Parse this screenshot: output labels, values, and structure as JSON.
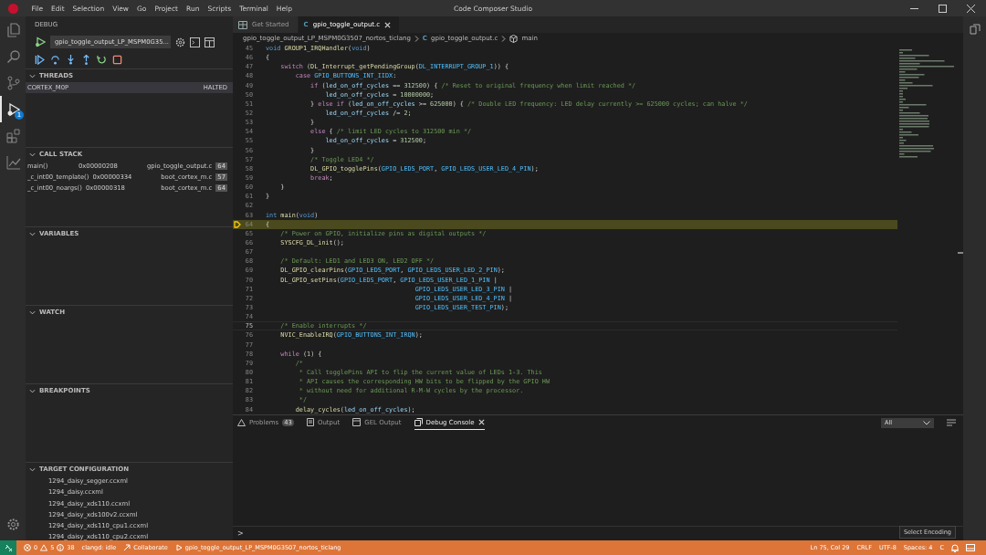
{
  "window": {
    "title": "Code Composer Studio"
  },
  "menu": [
    "File",
    "Edit",
    "Selection",
    "View",
    "Go",
    "Project",
    "Run",
    "Scripts",
    "Terminal",
    "Help"
  ],
  "activity_bar": [
    {
      "kind": "files",
      "selected": false
    },
    {
      "kind": "search",
      "selected": false
    },
    {
      "kind": "source-control",
      "selected": false
    },
    {
      "kind": "debug",
      "selected": true,
      "badge": "1"
    },
    {
      "kind": "extensions",
      "selected": false
    },
    {
      "kind": "chart",
      "selected": false
    }
  ],
  "sidebar": {
    "title": "DEBUG",
    "launch_config": "gpio_toggle_output_LP_MSPM0G35...",
    "sections": [
      {
        "kind": "threads",
        "title": "THREADS",
        "expanded": true,
        "rows": [
          {
            "name": "CORTEX_M0P",
            "state": "HALTED",
            "selected": true
          }
        ]
      },
      {
        "kind": "callstack",
        "title": "CALL STACK",
        "expanded": true,
        "frames": [
          {
            "name": "main()",
            "address": "0x00000208",
            "file": "gpio_toggle_output.c",
            "line": "64"
          },
          {
            "name": "_c_int00_template()",
            "address": "0x00000334",
            "file": "boot_cortex_m.c",
            "line": "57"
          },
          {
            "name": "_c_int00_noargs()",
            "address": "0x00000318",
            "file": "boot_cortex_m.c",
            "line": "64"
          }
        ]
      },
      {
        "kind": "empty",
        "title": "VARIABLES",
        "expanded": true
      },
      {
        "kind": "empty",
        "title": "WATCH",
        "expanded": true
      },
      {
        "kind": "empty",
        "title": "BREAKPOINTS",
        "expanded": true
      },
      {
        "kind": "files",
        "title": "TARGET CONFIGURATION",
        "expanded": true,
        "items": [
          "1294_daisy_segger.ccxml",
          "1294_daisy.ccxml",
          "1294_daisy_xds110.ccxml",
          "1294_daisy_xds100v2.ccxml",
          "1294_daisy_xds110_cpu1.ccxml",
          "1294_daisy_xds110_cpu2.ccxml"
        ]
      }
    ]
  },
  "editor": {
    "tabs": [
      {
        "label": "Get Started",
        "kind": "welcome",
        "selected": false
      },
      {
        "label": "gpio_toggle_output.c",
        "kind": "c",
        "icon": "C",
        "selected": true
      }
    ],
    "breadcrumb": [
      {
        "label": "gpio_toggle_output_LP_MSPM0G3507_nortos_ticlang",
        "kind": "folder"
      },
      {
        "label": "gpio_toggle_output.c",
        "kind": "file",
        "icon": "C"
      },
      {
        "label": "main",
        "kind": "symbol"
      }
    ],
    "lines": [
      {
        "n": "45",
        "tokens": [
          {
            "kind": "ty",
            "text": "void"
          },
          {
            "kind": "fn",
            "text": " GROUP1_IRQHandler"
          },
          {
            "kind": "p",
            "text": "("
          },
          {
            "kind": "ty",
            "text": "void"
          },
          {
            "kind": "p",
            "text": ")"
          }
        ]
      },
      {
        "n": "46",
        "tokens": [
          {
            "kind": "p",
            "text": "{"
          }
        ]
      },
      {
        "n": "47",
        "tokens": [
          {
            "kind": "kw",
            "text": "    switch"
          },
          {
            "kind": "p",
            "text": " ("
          },
          {
            "kind": "fn",
            "text": "DL_Interrupt_getPendingGroup"
          },
          {
            "kind": "p",
            "text": "("
          },
          {
            "kind": "mac",
            "text": "DL_INTERRUPT_GROUP_1"
          },
          {
            "kind": "p",
            "text": ")) {"
          }
        ]
      },
      {
        "n": "48",
        "tokens": [
          {
            "kind": "kw",
            "text": "        case"
          },
          {
            "kind": "mac",
            "text": " GPIO_BUTTONS_INT_IIDX"
          },
          {
            "kind": "p",
            "text": ":"
          }
        ]
      },
      {
        "n": "49",
        "tokens": [
          {
            "kind": "kw",
            "text": "            if"
          },
          {
            "kind": "p",
            "text": " ("
          },
          {
            "kind": "var",
            "text": "led_on_off_cycles"
          },
          {
            "kind": "p",
            "text": " == "
          },
          {
            "kind": "num",
            "text": "312500"
          },
          {
            "kind": "p",
            "text": ") { "
          },
          {
            "kind": "cm",
            "text": "/* Reset to original frequency when limit reached */"
          }
        ]
      },
      {
        "n": "50",
        "tokens": [
          {
            "kind": "var",
            "text": "                led_on_off_cycles"
          },
          {
            "kind": "p",
            "text": " = "
          },
          {
            "kind": "num",
            "text": "10000000"
          },
          {
            "kind": "p",
            "text": ";"
          }
        ]
      },
      {
        "n": "51",
        "tokens": [
          {
            "kind": "p",
            "text": "            } "
          },
          {
            "kind": "kw",
            "text": "else if"
          },
          {
            "kind": "p",
            "text": " ("
          },
          {
            "kind": "var",
            "text": "led_on_off_cycles"
          },
          {
            "kind": "p",
            "text": " >= "
          },
          {
            "kind": "num",
            "text": "625000"
          },
          {
            "kind": "p",
            "text": ") { "
          },
          {
            "kind": "cm",
            "text": "/* Double LED frequency: LED delay currently >= 625000 cycles; can halve */"
          }
        ]
      },
      {
        "n": "52",
        "tokens": [
          {
            "kind": "var",
            "text": "                led_on_off_cycles"
          },
          {
            "kind": "p",
            "text": " /= "
          },
          {
            "kind": "num",
            "text": "2"
          },
          {
            "kind": "p",
            "text": ";"
          }
        ]
      },
      {
        "n": "53",
        "tokens": [
          {
            "kind": "p",
            "text": "            }"
          }
        ]
      },
      {
        "n": "54",
        "tokens": [
          {
            "kind": "kw",
            "text": "            else"
          },
          {
            "kind": "p",
            "text": " { "
          },
          {
            "kind": "cm",
            "text": "/* limit LED cycles to 312500 min */"
          }
        ]
      },
      {
        "n": "55",
        "tokens": [
          {
            "kind": "var",
            "text": "                led_on_off_cycles"
          },
          {
            "kind": "p",
            "text": " = "
          },
          {
            "kind": "num",
            "text": "312500"
          },
          {
            "kind": "p",
            "text": ";"
          }
        ]
      },
      {
        "n": "56",
        "tokens": [
          {
            "kind": "p",
            "text": "            }"
          }
        ]
      },
      {
        "n": "57",
        "tokens": [
          {
            "kind": "cm",
            "text": "            /* Toggle LED4 */"
          }
        ]
      },
      {
        "n": "58",
        "tokens": [
          {
            "kind": "fn",
            "text": "            DL_GPIO_togglePins"
          },
          {
            "kind": "p",
            "text": "("
          },
          {
            "kind": "mac",
            "text": "GPIO_LEDS_PORT"
          },
          {
            "kind": "p",
            "text": ", "
          },
          {
            "kind": "mac",
            "text": "GPIO_LEDS_USER_LED_4_PIN"
          },
          {
            "kind": "p",
            "text": ");"
          }
        ]
      },
      {
        "n": "59",
        "tokens": [
          {
            "kind": "kw",
            "text": "            break"
          },
          {
            "kind": "p",
            "text": ";"
          }
        ]
      },
      {
        "n": "60",
        "tokens": [
          {
            "kind": "p",
            "text": "    }"
          }
        ]
      },
      {
        "n": "61",
        "tokens": [
          {
            "kind": "p",
            "text": "}"
          }
        ]
      },
      {
        "n": "62"
      },
      {
        "n": "63",
        "tokens": [
          {
            "kind": "ty",
            "text": "int"
          },
          {
            "kind": "fn",
            "text": " main"
          },
          {
            "kind": "p",
            "text": "("
          },
          {
            "kind": "ty",
            "text": "void"
          },
          {
            "kind": "p",
            "text": ")"
          }
        ]
      },
      {
        "n": "64",
        "current": true,
        "tokens": [
          {
            "kind": "p",
            "text": "{"
          }
        ]
      },
      {
        "n": "65",
        "tokens": [
          {
            "kind": "cm",
            "text": "    /* Power on GPIO, initialize pins as digital outputs */"
          }
        ]
      },
      {
        "n": "66",
        "tokens": [
          {
            "kind": "fn",
            "text": "    SYSCFG_DL_init"
          },
          {
            "kind": "p",
            "text": "();"
          }
        ]
      },
      {
        "n": "67"
      },
      {
        "n": "68",
        "tokens": [
          {
            "kind": "cm",
            "text": "    /* Default: LED1 and LED3 ON, LED2 OFF */"
          }
        ]
      },
      {
        "n": "69",
        "tokens": [
          {
            "kind": "fn",
            "text": "    DL_GPIO_clearPins"
          },
          {
            "kind": "p",
            "text": "("
          },
          {
            "kind": "mac",
            "text": "GPIO_LEDS_PORT"
          },
          {
            "kind": "p",
            "text": ", "
          },
          {
            "kind": "mac",
            "text": "GPIO_LEDS_USER_LED_2_PIN"
          },
          {
            "kind": "p",
            "text": ");"
          }
        ]
      },
      {
        "n": "70",
        "tokens": [
          {
            "kind": "fn",
            "text": "    DL_GPIO_setPins"
          },
          {
            "kind": "p",
            "text": "("
          },
          {
            "kind": "mac",
            "text": "GPIO_LEDS_PORT"
          },
          {
            "kind": "p",
            "text": ", "
          },
          {
            "kind": "mac",
            "text": "GPIO_LEDS_USER_LED_1_PIN"
          },
          {
            "kind": "p",
            "text": " |"
          }
        ]
      },
      {
        "n": "71",
        "tokens": [
          {
            "kind": "mac",
            "text": "                                        GPIO_LEDS_USER_LED_3_PIN"
          },
          {
            "kind": "p",
            "text": " |"
          }
        ]
      },
      {
        "n": "72",
        "tokens": [
          {
            "kind": "mac",
            "text": "                                        GPIO_LEDS_USER_LED_4_PIN"
          },
          {
            "kind": "p",
            "text": " |"
          }
        ]
      },
      {
        "n": "73",
        "tokens": [
          {
            "kind": "mac",
            "text": "                                        GPIO_LEDS_USER_TEST_PIN"
          },
          {
            "kind": "p",
            "text": ");"
          }
        ]
      },
      {
        "n": "74"
      },
      {
        "n": "75",
        "cursor": true,
        "tokens": [
          {
            "kind": "cm",
            "text": "    /* Enable interrupts */"
          }
        ]
      },
      {
        "n": "76",
        "tokens": [
          {
            "kind": "fn",
            "text": "    NVIC_EnableIRQ"
          },
          {
            "kind": "p",
            "text": "("
          },
          {
            "kind": "mac",
            "text": "GPIO_BUTTONS_INT_IRQN"
          },
          {
            "kind": "p",
            "text": ");"
          }
        ]
      },
      {
        "n": "77"
      },
      {
        "n": "78",
        "tokens": [
          {
            "kind": "kw",
            "text": "    while"
          },
          {
            "kind": "p",
            "text": " ("
          },
          {
            "kind": "num",
            "text": "1"
          },
          {
            "kind": "p",
            "text": ") {"
          }
        ]
      },
      {
        "n": "79",
        "tokens": [
          {
            "kind": "cm",
            "text": "        /*"
          }
        ]
      },
      {
        "n": "80",
        "tokens": [
          {
            "kind": "cm",
            "text": "         * Call togglePins API to flip the current value of LEDs 1-3. This"
          }
        ]
      },
      {
        "n": "81",
        "tokens": [
          {
            "kind": "cm",
            "text": "         * API causes the corresponding HW bits to be flipped by the GPIO HW"
          }
        ]
      },
      {
        "n": "82",
        "tokens": [
          {
            "kind": "cm",
            "text": "         * without need for additional R-M-W cycles by the processor."
          }
        ]
      },
      {
        "n": "83",
        "tokens": [
          {
            "kind": "cm",
            "text": "         */"
          }
        ]
      },
      {
        "n": "84",
        "tokens": [
          {
            "kind": "fn",
            "text": "        delay_cycles"
          },
          {
            "kind": "p",
            "text": "("
          },
          {
            "kind": "var",
            "text": "led_on_off_cycles"
          },
          {
            "kind": "p",
            "text": ");"
          }
        ]
      }
    ]
  },
  "panel": {
    "tabs": [
      {
        "label": "Problems",
        "kind": "problems",
        "badge": "43",
        "selected": false
      },
      {
        "label": "Output",
        "kind": "output",
        "selected": false
      },
      {
        "label": "GEL Output",
        "kind": "gel",
        "selected": false
      },
      {
        "label": "Debug Console",
        "kind": "console",
        "selected": true
      }
    ],
    "filter": "All",
    "prompt": ">"
  },
  "tooltip": "Select Encoding",
  "status_bar": {
    "errors": "0",
    "warnings": "5",
    "infos": "38",
    "left": [
      "clangd: idle",
      "Collaborate",
      "gpio_toggle_output_LP_MSPM0G3507_nortos_ticlang"
    ],
    "right": [
      "Ln 75, Col 29",
      "CRLF",
      "UTF-8",
      "Spaces: 4",
      "C"
    ]
  }
}
